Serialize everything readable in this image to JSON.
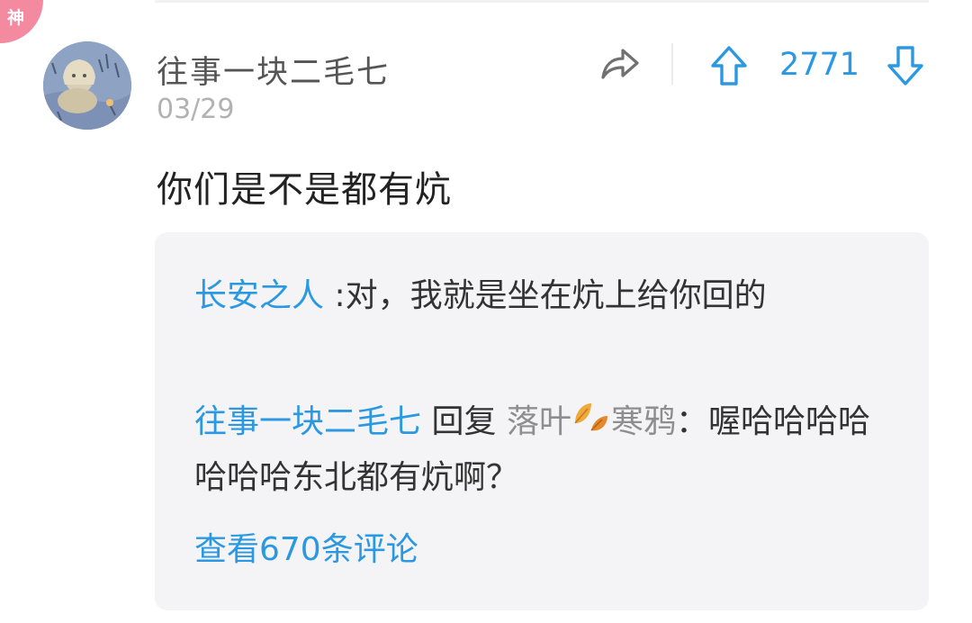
{
  "badge": {
    "label": "神",
    "color": "#f48aa0"
  },
  "post": {
    "username": "往事一块二毛七",
    "date": "03/29",
    "vote_count": "2771",
    "content": "你们是不是都有炕"
  },
  "replies": [
    {
      "author": "长安之人",
      "separator": ":",
      "text": "对，我就是坐在炕上给你回的"
    },
    {
      "author": "往事一块二毛七",
      "reply_word": "回复",
      "target": "落叶",
      "target_suffix": "寒鸦",
      "separator": "：",
      "text": "喔哈哈哈哈哈哈哈东北都有炕啊？"
    }
  ],
  "view_all_label": "查看670条评论",
  "colors": {
    "accent": "#2b98e2",
    "muted": "#b2b2b2",
    "reply_bg": "#f4f4f6"
  },
  "icons": {
    "share": "share-arrow-icon",
    "upvote": "arrow-up-icon",
    "downvote": "arrow-down-icon",
    "leaf": "leaf-emoji-icon"
  }
}
